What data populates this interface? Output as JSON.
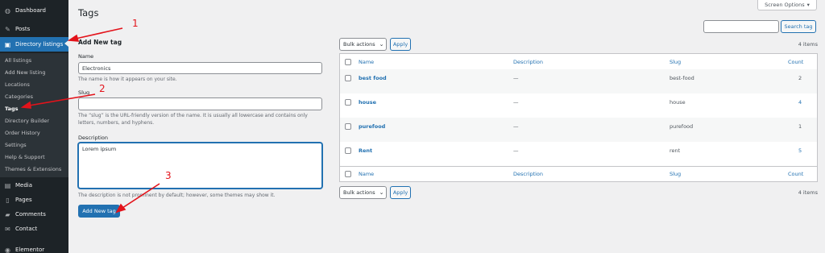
{
  "sidebar": {
    "top": [
      {
        "label": "Dashboard",
        "icon": "dashboard-icon",
        "glyph": "◍"
      },
      {
        "label": "Posts",
        "icon": "pin-icon",
        "glyph": "✎"
      },
      {
        "label": "Directory listings",
        "icon": "directory-icon",
        "glyph": "▣"
      }
    ],
    "submenu": [
      "All listings",
      "Add New listing",
      "Locations",
      "Categories",
      "Tags",
      "Directory Builder",
      "Order History",
      "Settings",
      "Help & Support",
      "Themes & Extensions"
    ],
    "bottom": [
      {
        "label": "Media",
        "icon": "media-icon",
        "glyph": "▤"
      },
      {
        "label": "Pages",
        "icon": "pages-icon",
        "glyph": "▯"
      },
      {
        "label": "Comments",
        "icon": "comments-icon",
        "glyph": "▰"
      },
      {
        "label": "Contact",
        "icon": "mail-icon",
        "glyph": "✉"
      },
      {
        "label": "Elementor",
        "icon": "elementor-icon",
        "glyph": "◉"
      }
    ]
  },
  "header": {
    "title": "Tags",
    "screen_options": "Screen Options",
    "screen_options_caret": "▾"
  },
  "search": {
    "value": "",
    "button": "Search tag"
  },
  "form": {
    "heading": "Add New tag",
    "name_label": "Name",
    "name_value": "Electronics",
    "name_hint": "The name is how it appears on your site.",
    "slug_label": "Slug",
    "slug_value": "",
    "slug_hint": "The “slug” is the URL-friendly version of the name. It is usually all lowercase and contains only letters, numbers, and hyphens.",
    "description_label": "Description",
    "description_value": "Lorem ipsum",
    "description_hint": "The description is not prominent by default; however, some themes may show it.",
    "submit": "Add New tag"
  },
  "bulk": {
    "label": "Bulk actions",
    "chevron": "⌄",
    "apply": "Apply",
    "items_count": "4 items"
  },
  "table": {
    "columns": {
      "name": "Name",
      "description": "Description",
      "slug": "Slug",
      "count": "Count"
    },
    "rows": [
      {
        "name": "best food",
        "description": "—",
        "slug": "best-food",
        "count": "2"
      },
      {
        "name": "house",
        "description": "—",
        "slug": "house",
        "count": "4"
      },
      {
        "name": "purefood",
        "description": "—",
        "slug": "purefood",
        "count": "1"
      },
      {
        "name": "Rent",
        "description": "—",
        "slug": "rent",
        "count": "5"
      }
    ]
  },
  "annotations": [
    "1",
    "2",
    "3"
  ],
  "colors": {
    "accent": "#2271b1",
    "sidebar": "#1d2327",
    "annotation": "#e3131b"
  }
}
